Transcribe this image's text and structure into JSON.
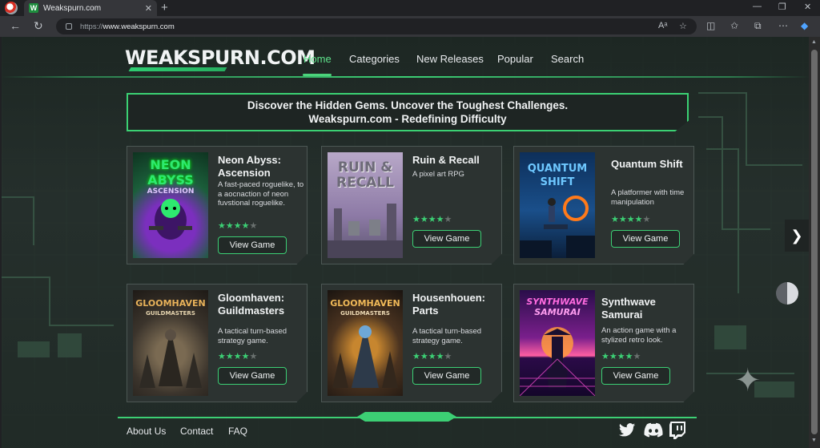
{
  "browser": {
    "tab_title": "Weakspurn.com",
    "tab_favicon": "W",
    "url_protocol": "https://",
    "url_host": "www.weakspurn.com"
  },
  "site": {
    "logo": "WEAKSPURN.COM",
    "nav": [
      {
        "label": "Home",
        "active": true
      },
      {
        "label": "Categories",
        "active": false
      },
      {
        "label": "New Releases",
        "active": false
      },
      {
        "label": "Popular",
        "active": false
      },
      {
        "label": "Search",
        "active": false
      }
    ],
    "banner_line1": "Discover the Hidden Gems. Uncover the Toughest Challenges.",
    "banner_line2": "Weakspurn.com - Redefining Difficulty",
    "button_label": "View Game"
  },
  "games": [
    {
      "title": "Neon Abyss: Ascension",
      "desc": "A fast-paced roguelike, to a aocnaction of neon fuvstional roguelike.",
      "rating": 4,
      "cover_text": "NEON ABYSS",
      "cover_sub": "ASCENSION"
    },
    {
      "title": "Ruin & Recall",
      "desc": "A pixel art RPG",
      "rating": 4,
      "cover_text": "RUIN & RECALL",
      "cover_sub": ""
    },
    {
      "title": "Quantum Shift",
      "desc": "A platformer with time manipulation",
      "rating": 4,
      "cover_text": "QUANTUM SHIFT",
      "cover_sub": ""
    },
    {
      "title": "Gloomhaven: Guildmasters",
      "desc": "A tactical turn-based strategy game.",
      "rating": 4,
      "cover_text": "GLOOMHAVEN",
      "cover_sub": "GUILDMASTERS"
    },
    {
      "title": "Housenhouen: Parts",
      "desc": "A tactical turn-based strategy game.",
      "rating": 4,
      "cover_text": "GLOOMHAVEN",
      "cover_sub": "GUILDMASTERS"
    },
    {
      "title": "Synthwave Samurai",
      "desc": "An action game with a stylized retro look.",
      "rating": 4,
      "cover_text": "SYNTHWAVE",
      "cover_sub": "SAMURAI"
    }
  ],
  "footer": {
    "links": [
      "About Us",
      "Contact",
      "FAQ"
    ],
    "social_icons": [
      "twitter-icon",
      "discord-icon",
      "twitch-icon"
    ]
  },
  "colors": {
    "accent": "#3ccf74",
    "background": "#26302c"
  }
}
